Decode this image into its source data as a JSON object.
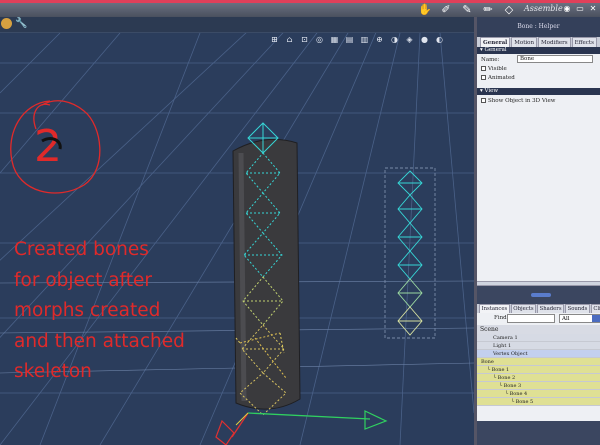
{
  "titlebar": {
    "title": "Assemble",
    "accent_color": "#e0405a",
    "tool_icons": [
      "hand-icon",
      "bone-tool-icon",
      "brush-icon",
      "pen-icon",
      "select-icon"
    ]
  },
  "viewport": {
    "annotation_text": "Created bones\nfor object after\nmorphs created\nand then attached\nskeleton",
    "annotation_number": "2",
    "annotation_color": "#e02a2a",
    "background": "#2b3d5c",
    "grid_color": "#4a6188"
  },
  "panel": {
    "header": "Bone : Helper",
    "tabs": [
      "General",
      "Motion",
      "Modifiers",
      "Effects"
    ],
    "active_tab": "General",
    "general_section": "General",
    "name_label": "Name:",
    "name_value": "Bone",
    "visible_label": "Visible",
    "animated_label": "Animated",
    "view_section": "View",
    "show_object_label": "Show Object in 3D View"
  },
  "browser": {
    "tabs": [
      "Instances",
      "Objects",
      "Shaders",
      "Sounds",
      "Clips"
    ],
    "active_tab": "Instances",
    "find_label": "Find",
    "find_value": "",
    "filter_value": "All",
    "scene_label": "Scene",
    "items": [
      {
        "label": "Camera 1",
        "indent": 0,
        "kind": "node"
      },
      {
        "label": "Light 1",
        "indent": 0,
        "kind": "node"
      },
      {
        "label": "Vertex Object",
        "indent": 0,
        "kind": "sel"
      },
      {
        "label": "Bone",
        "indent": 0,
        "kind": "bone"
      },
      {
        "label": "Bone 1",
        "indent": 1,
        "kind": "bone"
      },
      {
        "label": "Bone 2",
        "indent": 2,
        "kind": "bone"
      },
      {
        "label": "Bone 3",
        "indent": 3,
        "kind": "bone"
      },
      {
        "label": "Bone 4",
        "indent": 4,
        "kind": "bone"
      },
      {
        "label": "Bone 5",
        "indent": 5,
        "kind": "bone"
      }
    ]
  }
}
